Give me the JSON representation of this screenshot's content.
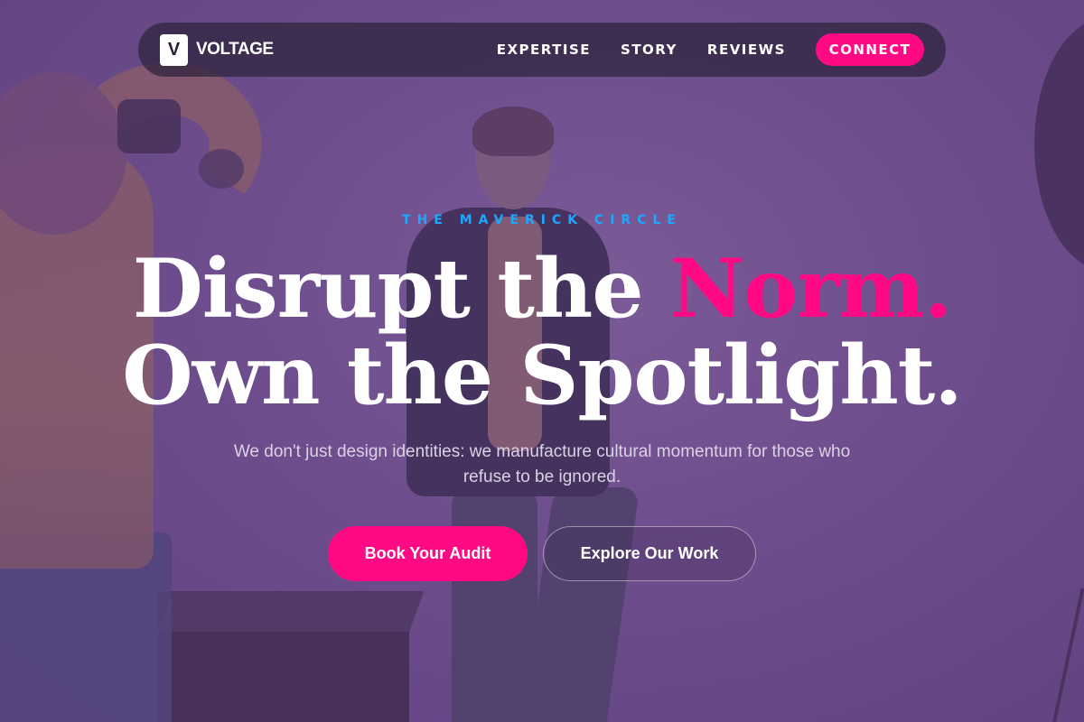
{
  "nav": {
    "brand_logo": "V",
    "brand_name": "VOLTAGE",
    "links": [
      {
        "label": "EXPERTISE"
      },
      {
        "label": "STORY"
      },
      {
        "label": "REVIEWS"
      }
    ],
    "cta_label": "CONNECT"
  },
  "hero": {
    "eyebrow": "THE MAVERICK CIRCLE",
    "headline_line1_pre": "Disrupt the ",
    "headline_line1_accent": "Norm.",
    "headline_line2": "Own the Spotlight.",
    "subtext": "We don't just design identities: we manufacture cultural momentum for those who refuse to be ignored.",
    "primary_button": "Book Your Audit",
    "secondary_button": "Explore Our Work"
  },
  "colors": {
    "accent": "#ff0a84",
    "eyebrow": "#1ea7ff",
    "background": "#6c4f86"
  }
}
